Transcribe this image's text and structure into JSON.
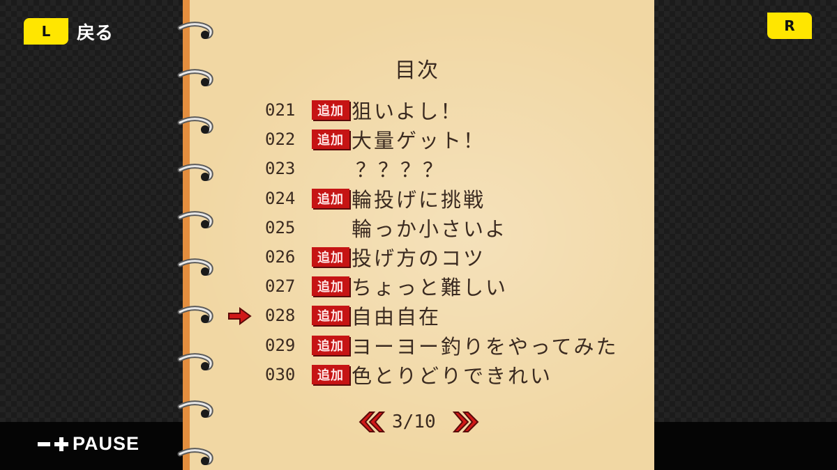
{
  "header": {
    "left_button": "L",
    "back_label": "戻る",
    "right_button": "R"
  },
  "footer": {
    "pause_label": "PAUSE"
  },
  "toc": {
    "title": "目次",
    "badge_label": "追加",
    "selected_index": 7,
    "entries": [
      {
        "num": "021",
        "title": "狙いよし！",
        "added": true
      },
      {
        "num": "022",
        "title": "大量ゲット！",
        "added": true
      },
      {
        "num": "023",
        "title": "？？？？",
        "added": false
      },
      {
        "num": "024",
        "title": "輪投げに挑戦",
        "added": true
      },
      {
        "num": "025",
        "title": "輪っか小さいよ",
        "added": false
      },
      {
        "num": "026",
        "title": "投げ方のコツ",
        "added": true
      },
      {
        "num": "027",
        "title": "ちょっと難しい",
        "added": true
      },
      {
        "num": "028",
        "title": "自由自在",
        "added": true
      },
      {
        "num": "029",
        "title": "ヨーヨー釣りをやってみた",
        "added": true
      },
      {
        "num": "030",
        "title": "色とりどりできれい",
        "added": true
      }
    ],
    "page_indicator": "3/10"
  },
  "colors": {
    "button_yellow": "#ffe600",
    "paper": "#f1d7a3",
    "badge_red": "#c61414",
    "arrow_red": "#d01818"
  }
}
